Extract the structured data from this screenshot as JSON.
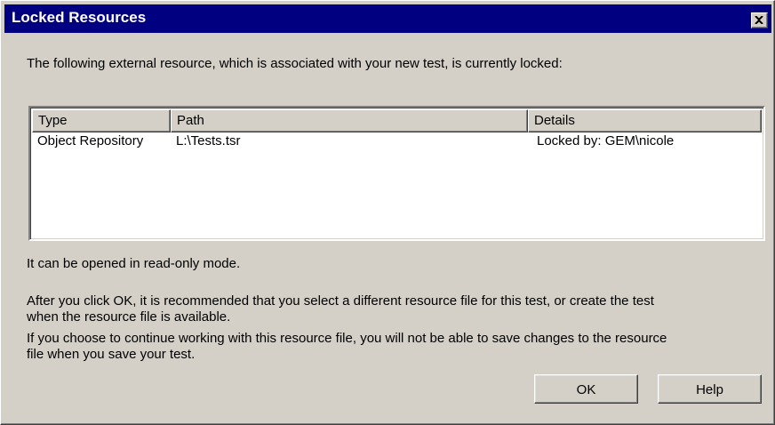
{
  "dialog": {
    "title": "Locked Resources",
    "intro": "The following external resource, which is associated with your new test, is currently locked:",
    "readonly_note": "It can be opened in read-only mode.",
    "paragraph1_line1": "After you click OK, it is recommended that you select a different resource file for this test, or create the test",
    "paragraph1_line2": "when the resource file is available.",
    "paragraph2_line1": "If you choose to continue working with this resource file, you will not be able to save changes to the resource",
    "paragraph2_line2": "file when you save your test."
  },
  "table": {
    "columns": [
      "Type",
      "Path",
      "Details"
    ],
    "rows": [
      {
        "type": "Object Repository",
        "path": "L:\\Tests.tsr",
        "details": "Locked by: GEM\\nicole"
      }
    ]
  },
  "buttons": {
    "ok": "OK",
    "help": "Help"
  },
  "icons": {
    "close": "close-icon"
  },
  "colors": {
    "titlebar": "#000080",
    "face": "#d4d0c8"
  }
}
